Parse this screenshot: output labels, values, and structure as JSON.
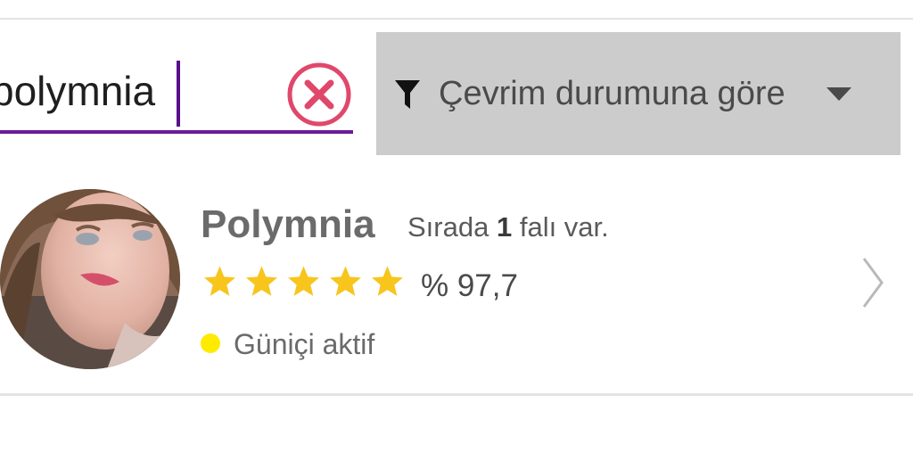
{
  "colors": {
    "accent_underline": "#6a1b9a",
    "clear_icon": "#e0486b",
    "filter_background": "#cccccc",
    "star": "#f7c51c",
    "status_dot": "#ffeb00"
  },
  "search": {
    "value": "polymnia",
    "clear_icon": "close-circle-icon"
  },
  "filter": {
    "icon": "filter-icon",
    "label": "Çevrim durumuna göre",
    "dropdown_icon": "caret-down-icon"
  },
  "result": {
    "name": "Polymnia",
    "queue_prefix": "Sırada",
    "queue_count": "1",
    "queue_suffix": "falı var.",
    "stars": 5,
    "rating": "% 97,7",
    "status": "Güniçi aktif",
    "chevron_icon": "chevron-right-icon"
  }
}
